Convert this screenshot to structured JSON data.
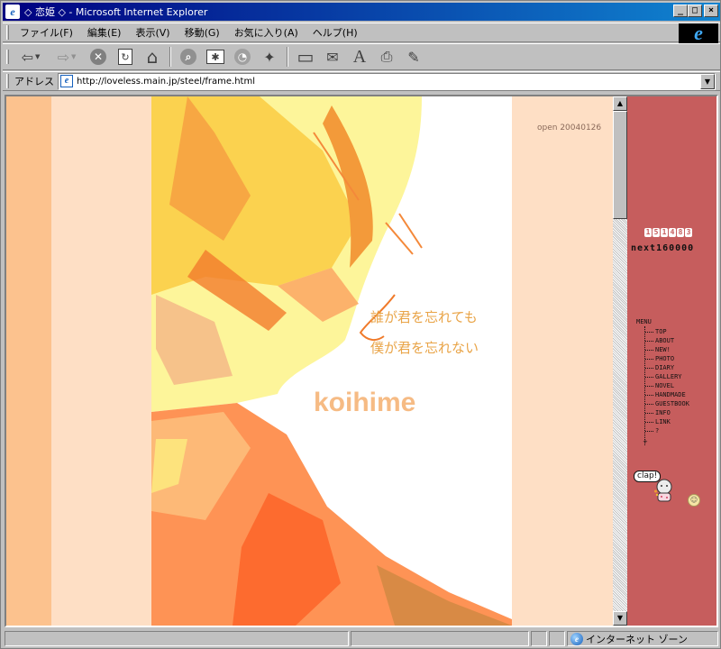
{
  "window": {
    "title": "◇ 恋姫 ◇ - Microsoft Internet Explorer",
    "controls": {
      "minimize": "_",
      "maximize": "□",
      "close": "×"
    }
  },
  "menubar": {
    "items": [
      {
        "label": "ファイル(F)"
      },
      {
        "label": "編集(E)"
      },
      {
        "label": "表示(V)"
      },
      {
        "label": "移動(G)"
      },
      {
        "label": "お気に入り(A)"
      },
      {
        "label": "ヘルプ(H)"
      }
    ],
    "brand_icon": "ie-logo-icon"
  },
  "toolbar": {
    "buttons": [
      {
        "name": "back",
        "icon": "back-arrow-icon",
        "glyph": "⇦"
      },
      {
        "name": "forward",
        "icon": "forward-arrow-icon",
        "glyph": "⇨"
      },
      {
        "name": "stop",
        "icon": "stop-icon",
        "glyph": "✕"
      },
      {
        "name": "refresh",
        "icon": "refresh-icon",
        "glyph": "↻"
      },
      {
        "name": "home",
        "icon": "home-icon",
        "glyph": "⌂"
      },
      {
        "name": "search",
        "icon": "search-icon",
        "glyph": "⌕"
      },
      {
        "name": "favorites",
        "icon": "favorites-icon",
        "glyph": "✱"
      },
      {
        "name": "history",
        "icon": "history-icon",
        "glyph": "◔"
      },
      {
        "name": "channels",
        "icon": "channels-icon",
        "glyph": "✦"
      },
      {
        "name": "fullscreen",
        "icon": "fullscreen-icon",
        "glyph": "▭"
      },
      {
        "name": "mail",
        "icon": "mail-icon",
        "glyph": "✉"
      },
      {
        "name": "font",
        "icon": "font-icon",
        "glyph": "A"
      },
      {
        "name": "print",
        "icon": "print-icon",
        "glyph": "⎙"
      },
      {
        "name": "edit",
        "icon": "edit-icon",
        "glyph": "✎"
      }
    ]
  },
  "address": {
    "label": "アドレス",
    "url": "http://loveless.main.jp/steel/frame.html"
  },
  "page": {
    "open_date": "open 20040126",
    "poem": {
      "line1": "誰が君を忘れても",
      "line2": "僕が君を忘れない"
    },
    "brand": "koihime",
    "colors": {
      "peach": "#fedfc5",
      "orange_stripe": "#fcc28e",
      "sidebar": "#c65d5d",
      "poem": "#e9a447",
      "brand": "#f6bb84"
    }
  },
  "sidebar": {
    "counter_digits": [
      "1",
      "5",
      "1",
      "4",
      "8",
      "3"
    ],
    "next_text": "next160000",
    "menu_title": "MENU",
    "menu_items": [
      {
        "label": "TOP"
      },
      {
        "label": "ABOUT"
      },
      {
        "label": "NEW!"
      },
      {
        "label": "PHOTO"
      },
      {
        "label": "DIARY"
      },
      {
        "label": "GALLERY"
      },
      {
        "label": "NOVEL"
      },
      {
        "label": "HANDMADE"
      },
      {
        "label": "GUESTBOOK"
      },
      {
        "label": "INFO"
      },
      {
        "label": "LINK"
      },
      {
        "label": "?"
      }
    ],
    "clap_label": "clap!"
  },
  "statusbar": {
    "zone": "インターネット ゾーン"
  }
}
